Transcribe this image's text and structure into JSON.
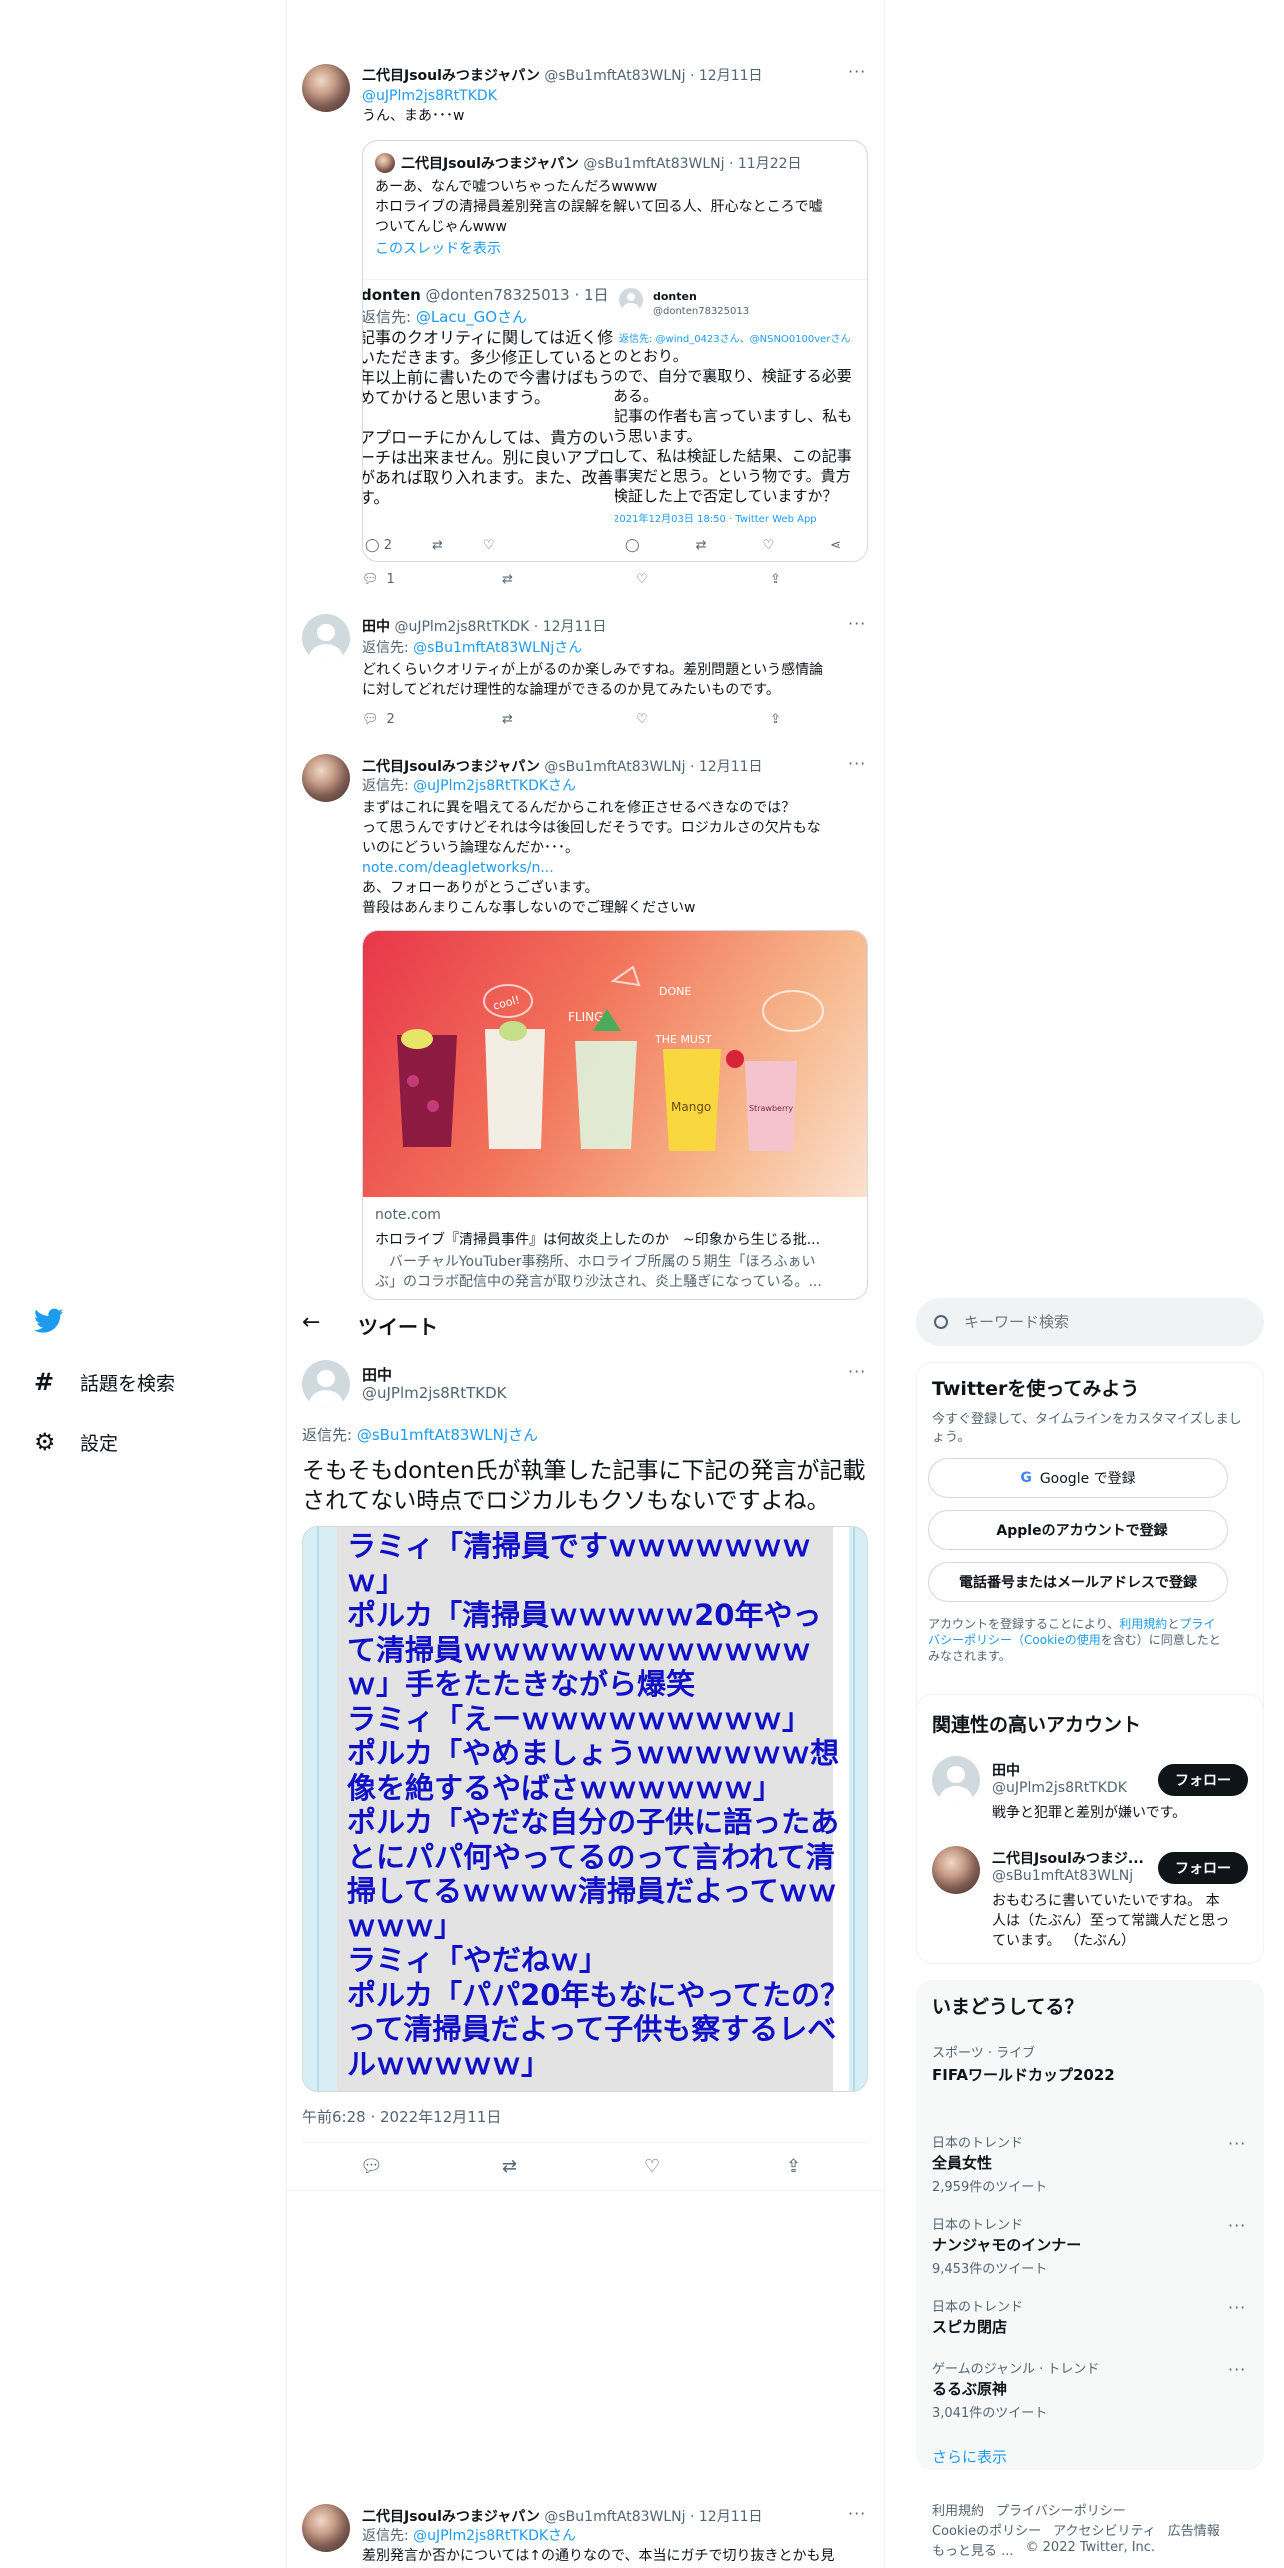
{
  "nav": {
    "explore_label": "話題を検索",
    "settings_label": "設定"
  },
  "header": {
    "title": "ツイート"
  },
  "search": {
    "placeholder": "キーワード検索"
  },
  "tweet1": {
    "name": "二代目Jsoulみつまジャパン",
    "handle": "@sBu1mftAt83WLNj",
    "date": "· 12月11日",
    "mention": "@uJPlm2js8RtTKDK",
    "text": "うん、まあ･･･w",
    "quote": {
      "name": "二代目Jsoulみつまジャパン",
      "handle": "@sBu1mftAt83WLNj",
      "date": "· 11月22日",
      "line1": "あーあ、なんで嘘ついちゃったんだろwwww",
      "line2": "ホロライブの清掃員差別発言の誤解を解いて回る人、肝心なところで嘘",
      "line3": "ついてんじゃんwww",
      "thread_link": "このスレッドを表示",
      "shot_a": {
        "name": "donten",
        "handle": "@donten78325013 · 1日",
        "reply_prefix": "返信先: ",
        "reply_to": "@Lacu_GOさん",
        "lines": [
          "記事のクオリティに関しては近く修",
          "いただきます。多少修正していると",
          "年以上前に書いたので今書けばもう",
          "めてかけると思いますう。",
          "",
          "アプローチにかんしては、貴方のい",
          "ーチは出来ません。別に良いアプロ",
          "があれば取り入れます。また、改善",
          "す。"
        ],
        "reply_count": "2"
      },
      "shot_b": {
        "name": "donten",
        "handle": "@donten78325013",
        "reply_line": "返信先: @wind_0423さん、@NSNO0100verさん",
        "lines": [
          "のとおり。",
          "ので、自分で裏取り、検証する必要",
          "ある。",
          "記事の作者も言っていますし、私も",
          "う思います。",
          "して、私は検証した結果、この記事",
          "事実だと思う。という物です。貴方",
          "検証した上で否定していますか？"
        ],
        "timestamp": "2021年12月03日 18:50 · Twitter Web App"
      }
    },
    "reply_count": "1"
  },
  "tweet2": {
    "name": "田中",
    "handle": "@uJPlm2js8RtTKDK",
    "date": "· 12月11日",
    "reply_prefix": "返信先: ",
    "reply_to": "@sBu1mftAt83WLNjさん",
    "line1": "どれくらいクオリティが上がるのか楽しみですね。差別問題という感情論",
    "line2": "に対してどれだけ理性的な論理ができるのか見てみたいものです。",
    "reply_count": "2"
  },
  "tweet3": {
    "name": "二代目Jsoulみつまジャパン",
    "handle": "@sBu1mftAt83WLNj",
    "date": "· 12月11日",
    "reply_prefix": "返信先: ",
    "reply_to": "@uJPlm2js8RtTKDKさん",
    "line1": "まずはこれに異を唱えてるんだからこれを修正させるべきなのでは？",
    "line2": "って思うんですけどそれは今は後回しだそうです。ロジカルさの欠片もな",
    "line3": "いのにどういう論理なんだか･･･。",
    "link": "note.com/deagletworks/n...",
    "line4": "あ、フォローありがとうございます。",
    "line5": "普段はあんまりこんな事しないのでご理解くださいw",
    "card": {
      "domain": "note.com",
      "title": "ホロライブ『清掃員事件』は何故炎上したのか　~印象から生じる批...",
      "desc": "　バーチャルYouTuber事務所、ホロライブ所属の５期生「ほろふぁい",
      "desc2": "ぶ」のコラボ配信中の発言が取り沙汰され、炎上騒ぎになっている。...",
      "art_labels": [
        "cool!",
        "THE MUST",
        "FLING!",
        "DONE",
        "Mango",
        "Strawberry"
      ]
    }
  },
  "main_tweet": {
    "name": "田中",
    "handle": "@uJPlm2js8RtTKDK",
    "reply_prefix": "返信先: ",
    "reply_to": "@sBu1mftAt83WLNjさん",
    "line1": "そもそもdonten氏が執筆した記事に下記の発言が記載",
    "line2": "されてない時点でロジカルもクソもないですよね。",
    "image_lines": [
      "ラミィ「清掃員ですｗｗｗｗｗｗｗ",
      "ｗ」",
      "ポルカ「清掃員ｗｗｗｗｗ20年やっ",
      "て清掃員ｗｗｗｗｗｗｗｗｗｗｗｗ",
      "ｗ」手をたたきながら爆笑",
      "ラミィ「えーｗｗｗｗｗｗｗｗｗ」",
      "ポルカ「やめましょうｗｗｗｗｗｗ想",
      "像を絶するやばさｗｗｗｗｗｗ」",
      "ポルカ「やだな自分の子供に語ったあ",
      "とにパパ何やってるのって言われて清",
      "掃してるｗｗｗｗ清掃員だよってｗｗ",
      "ｗｗｗ」",
      "ラミィ「やだねｗ」",
      "ポルカ「パパ20年もなにやってたの？",
      "って清掃員だよって子供も察するレベ",
      "ルｗｗｗｗｗ」"
    ],
    "timestamp": "午前6:28 · 2022年12月11日"
  },
  "tweet_bottom": {
    "name": "二代目Jsoulみつまジャパン",
    "handle": "@sBu1mftAt83WLNj",
    "date": "· 12月11日",
    "reply_prefix": "返信先: ",
    "reply_to": "@uJPlm2js8RtTKDKさん",
    "line1": "差別発言か否かについては↑の通りなので、本当にガチで切り抜きとかも見"
  },
  "signup": {
    "title": "Twitterを使ってみよう",
    "desc1": "今すぐ登録して、タイムラインをカスタマイズしまし",
    "desc2": "ょう。",
    "google": "Google で登録",
    "apple": "Appleのアカウントで登録",
    "phone": "電話番号またはメールアドレスで登録",
    "terms1a": "アカウントを登録することにより、",
    "terms1b": "利用規約",
    "terms1c": "と",
    "terms1d": "プライ",
    "terms2a": "バシーポリシー（",
    "terms2b": "Cookieの使用",
    "terms2c": "を含む）に同意したと",
    "terms3": "みなされます。"
  },
  "related": {
    "title": "関連性の高いアカウント",
    "follow_label": "フォロー",
    "accounts": [
      {
        "name": "田中",
        "handle": "@uJPlm2js8RtTKDK",
        "bio1": "戦争と犯罪と差別が嫌いです。",
        "bio2": "",
        "bio3": ""
      },
      {
        "name": "二代目Jsoulみつまジ...",
        "handle": "@sBu1mftAt83WLNj",
        "bio1": "おもむろに書いていたいですね。 本",
        "bio2": "人は（たぶん）至って常識人だと思っ",
        "bio3": "ています。 （たぶん）"
      }
    ]
  },
  "trends": {
    "title": "いまどうしてる？",
    "items": [
      {
        "context": "スポーツ · ライブ",
        "name": "FIFAワールドカップ2022",
        "count": ""
      },
      {
        "context": "日本のトレンド",
        "name": "全員女性",
        "count": "2,959件のツイート"
      },
      {
        "context": "日本のトレンド",
        "name": "ナンジャモのインナー",
        "count": "9,453件のツイート"
      },
      {
        "context": "日本のトレンド",
        "name": "スピカ閉店",
        "count": ""
      },
      {
        "context": "ゲームのジャンル · トレンド",
        "name": "るるぶ原神",
        "count": "3,041件のツイート"
      }
    ],
    "show_more": "さらに表示"
  },
  "footer": {
    "links1": [
      "利用規約",
      "プライバシーポリシー"
    ],
    "links2": [
      "Cookieのポリシー",
      "アクセシビリティ",
      "広告情報"
    ],
    "more": "もっと見る ...",
    "copyright": "© 2022 Twitter, Inc."
  },
  "colors": {
    "accent": "#1d9bf0",
    "text": "#0f1419",
    "muted": "#536471",
    "manga_blue": "#1010c8"
  }
}
